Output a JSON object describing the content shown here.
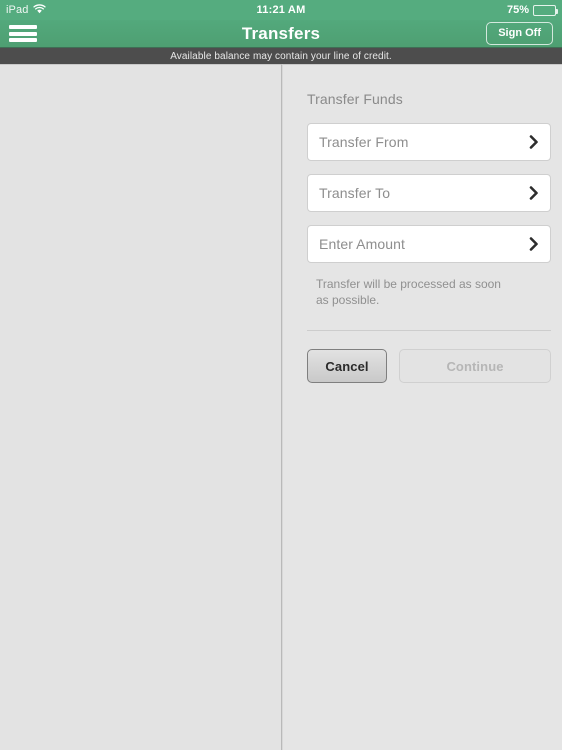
{
  "status_bar": {
    "device": "iPad",
    "wifi_icon": "wifi-icon",
    "time": "11:21 AM",
    "battery_percent": "75%",
    "battery_icon": "battery-icon",
    "battery_level": 75
  },
  "nav_bar": {
    "menu_icon": "hamburger-menu-icon",
    "title": "Transfers",
    "sign_off_label": "Sign Off"
  },
  "alert": {
    "message": "Available balance may contain your line of credit."
  },
  "main": {
    "section_title": "Transfer Funds",
    "rows": [
      {
        "label": "Transfer From",
        "value": "",
        "chevron": "chevron-right-icon"
      },
      {
        "label": "Transfer To",
        "value": "",
        "chevron": "chevron-right-icon"
      },
      {
        "label": "Enter Amount",
        "value": "",
        "chevron": "chevron-right-icon"
      }
    ],
    "helper_text": "Transfer will be processed as soon as possible.",
    "buttons": {
      "cancel_label": "Cancel",
      "continue_label": "Continue"
    }
  },
  "colors": {
    "brand_green": "#4fa173",
    "status_green": "#55ac7f",
    "banner_dark": "#4d4d4d",
    "page_background": "#e3e3e3",
    "row_white": "#ffffff"
  }
}
